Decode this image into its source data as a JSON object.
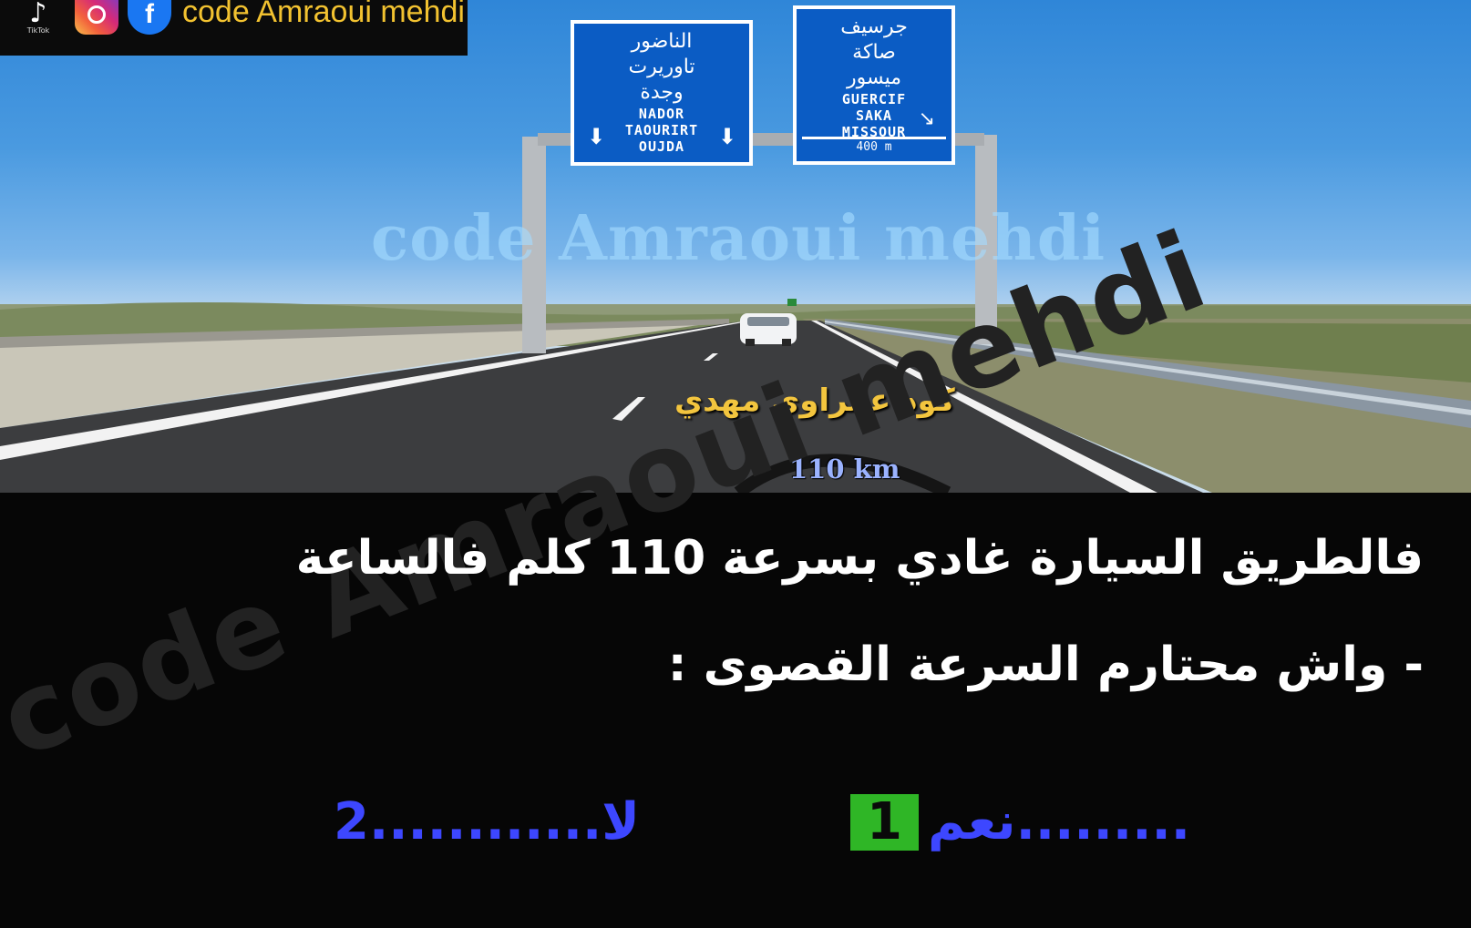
{
  "banner": {
    "tiktok_label": "TikTok",
    "facebook_glyph": "f",
    "brand_text": "code Amraoui mehdi"
  },
  "scene": {
    "watermark": "code Amraoui mehdi",
    "sign_left": {
      "ar": [
        "الناضور",
        "تاوريرت",
        "وجدة"
      ],
      "lat": [
        "NADOR",
        "TAOURIRT",
        "OUJDA"
      ]
    },
    "sign_right": {
      "ar": [
        "جرسيف",
        "صاكة",
        "ميسور"
      ],
      "lat": [
        "GUERCIF",
        "SAKA",
        "MISSOUR"
      ],
      "distance": "400 m"
    },
    "caption": "كود عمراوي مهدي",
    "speed": "110 km"
  },
  "question": {
    "line1": "فالطريق السيارة غادي بسرعة 110 كلم فالساعة",
    "line2": "- واش محتارم السرعة القصوى :"
  },
  "answers": [
    {
      "label": "نعم.........",
      "number": "1",
      "highlight": "#2fb626"
    },
    {
      "label": "لا............2",
      "number": "2"
    }
  ],
  "bottom_watermark": "code Amraoui mehdi",
  "colors": {
    "sky": "#3b8fdc",
    "sign_blue": "#0b5cc4",
    "answer_blue": "#3d47ff",
    "caption_yellow": "#f3c53e",
    "brand_yellow": "#f2c230"
  }
}
